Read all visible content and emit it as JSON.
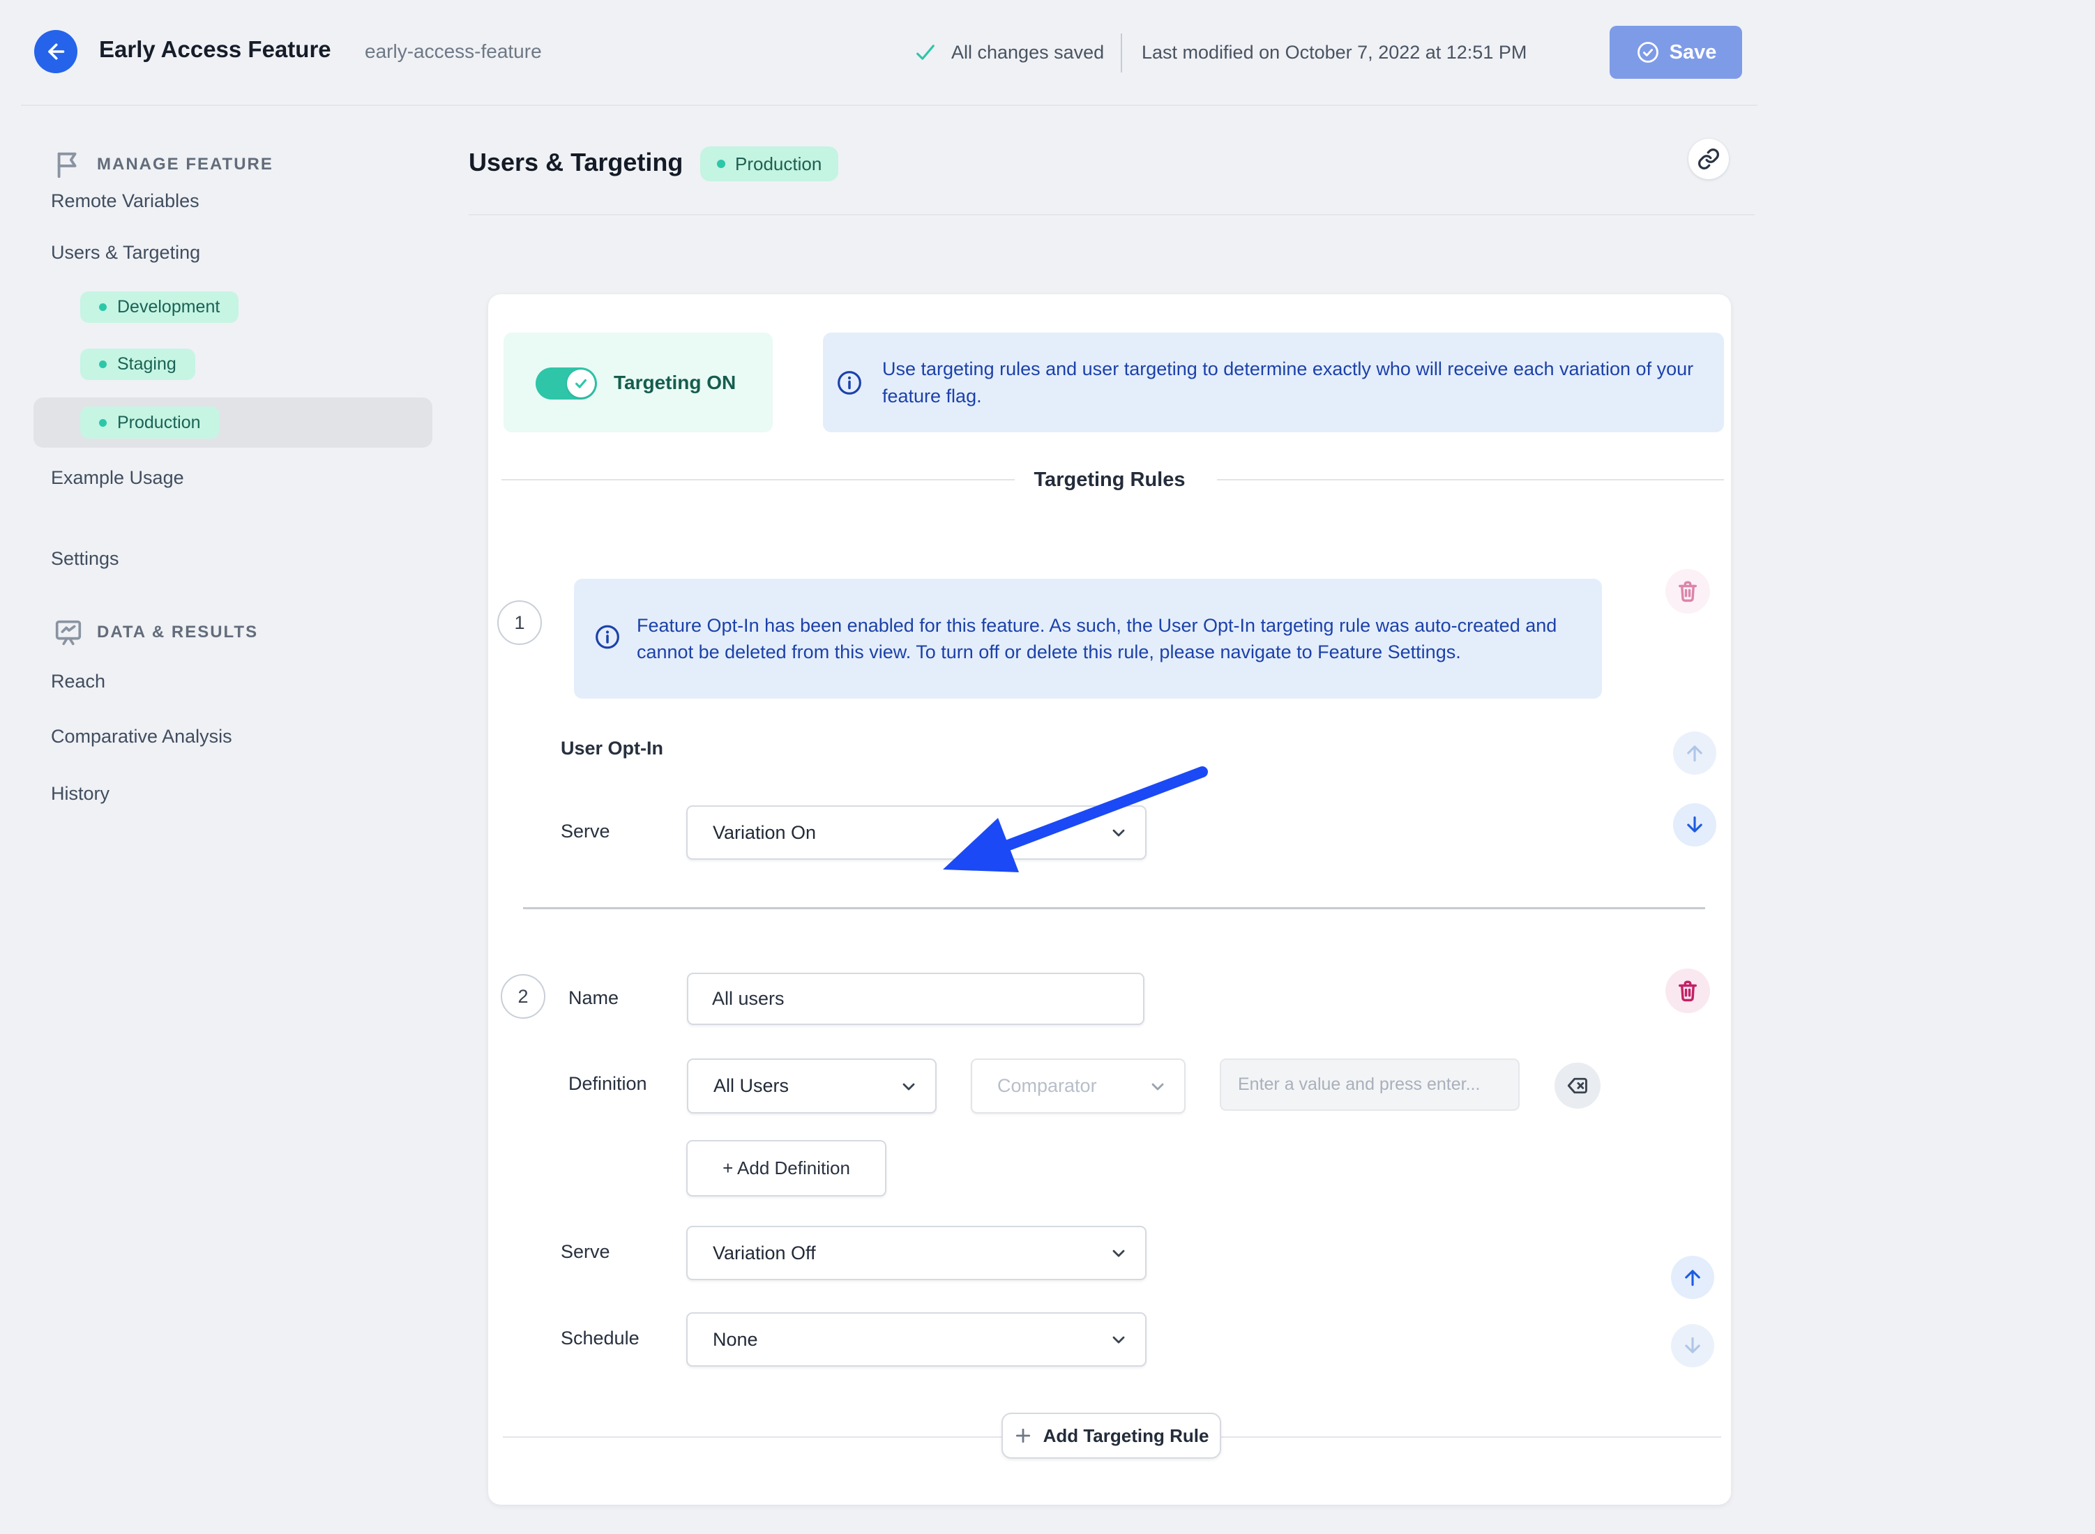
{
  "header": {
    "title": "Early Access Feature",
    "slug": "early-access-feature",
    "saved_status": "All changes saved",
    "last_modified": "Last modified on October 7, 2022 at 12:51 PM",
    "save_label": "Save"
  },
  "sidebar": {
    "manage_header": "MANAGE FEATURE",
    "data_header": "DATA & RESULTS",
    "items": {
      "remote_variables": "Remote Variables",
      "users_targeting": "Users & Targeting",
      "example_usage": "Example Usage",
      "settings": "Settings",
      "reach": "Reach",
      "comparative_analysis": "Comparative Analysis",
      "history": "History"
    },
    "environments": [
      "Development",
      "Staging",
      "Production"
    ],
    "active_environment": "Production"
  },
  "main": {
    "title": "Users & Targeting",
    "environment_badge": "Production",
    "toggle_label": "Targeting ON",
    "toggle_state": "on",
    "banner": "Use targeting rules and user targeting to determine exactly who will receive each variation of your feature flag.",
    "section_title": "Targeting Rules",
    "rule1": {
      "number": "1",
      "notice": "Feature Opt-In has been enabled for this feature. As such, the User Opt-In targeting rule was auto-created and cannot be deleted from this view. To turn off or delete this rule, please navigate to Feature Settings.",
      "title": "User Opt-In",
      "serve_label": "Serve",
      "serve_value": "Variation On"
    },
    "rule2": {
      "number": "2",
      "name_label": "Name",
      "name_value": "All users",
      "definition_label": "Definition",
      "definition_value": "All Users",
      "comparator_placeholder": "Comparator",
      "value_placeholder": "Enter a value and press enter...",
      "add_definition_label": "+ Add Definition",
      "serve_label": "Serve",
      "serve_value": "Variation Off",
      "schedule_label": "Schedule",
      "schedule_value": "None"
    },
    "add_rule_label": "Add Targeting Rule"
  },
  "colors": {
    "accent_teal": "#2EC5A8",
    "accent_blue": "#2563EB",
    "save_button_disabled": "#7E9BE8",
    "info_text_blue": "#1C41A9",
    "info_bg": "#E4EEFB",
    "mint_bg": "#C6F5E3",
    "danger_pink": "#C32166",
    "annotation_arrow_blue": "#1B49F5",
    "page_bg": "#EFF1F5"
  }
}
